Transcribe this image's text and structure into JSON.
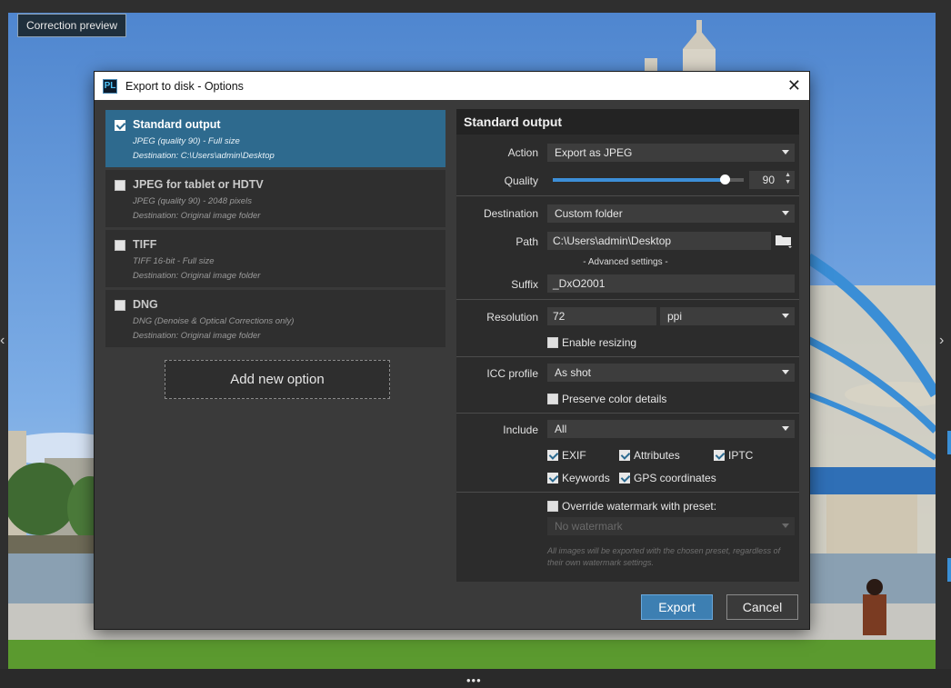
{
  "background": {
    "correction_preview_label": "Correction preview",
    "left_arrow": "‹",
    "right_arrow": "›",
    "bottom_handle": "•••"
  },
  "dialog": {
    "app_icon_text": "PL",
    "title": "Export to disk - Options",
    "close_glyph": "✕",
    "presets": [
      {
        "name": "Standard output",
        "line1": "JPEG (quality 90) - Full size",
        "line2": "Destination: C:\\Users\\admin\\Desktop",
        "checked": true,
        "selected": true
      },
      {
        "name": "JPEG for tablet or HDTV",
        "line1": "JPEG (quality 90) - 2048 pixels",
        "line2": "Destination: Original image folder",
        "checked": false,
        "selected": false
      },
      {
        "name": "TIFF",
        "line1": "TIFF 16-bit - Full size",
        "line2": "Destination: Original image folder",
        "checked": false,
        "selected": false
      },
      {
        "name": "DNG",
        "line1": "DNG (Denoise & Optical Corrections only)",
        "line2": "Destination: Original image folder",
        "checked": false,
        "selected": false
      }
    ],
    "add_option_label": "Add new option",
    "panel": {
      "header": "Standard output",
      "action_label": "Action",
      "action_value": "Export as JPEG",
      "quality_label": "Quality",
      "quality_value": "90",
      "quality_fraction": 0.9,
      "destination_label": "Destination",
      "destination_value": "Custom folder",
      "path_label": "Path",
      "path_value": "C:\\Users\\admin\\Desktop",
      "advanced_settings": "- Advanced settings -",
      "suffix_label": "Suffix",
      "suffix_value": "_DxO2001",
      "resolution_label": "Resolution",
      "resolution_value": "72",
      "resolution_unit": "ppi",
      "enable_resizing": "Enable resizing",
      "icc_label": "ICC profile",
      "icc_value": "As shot",
      "preserve_color": "Preserve color details",
      "include_label": "Include",
      "include_value": "All",
      "exif": "EXIF",
      "attributes": "Attributes",
      "iptc": "IPTC",
      "keywords": "Keywords",
      "gps": "GPS coordinates",
      "override_watermark": "Override watermark with preset:",
      "watermark_value": "No watermark",
      "watermark_note": "All images will be exported with the chosen preset, regardless of their own watermark settings."
    },
    "export_label": "Export",
    "cancel_label": "Cancel"
  },
  "colors": {
    "accent": "#3d8fd8",
    "selected_preset": "#2e6a8e",
    "dialog_bg": "#3a3a3a"
  }
}
